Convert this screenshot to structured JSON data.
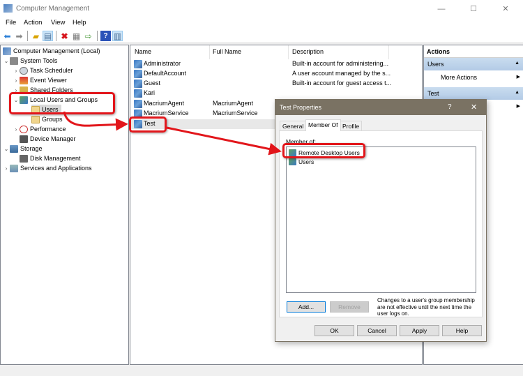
{
  "window": {
    "title": "Computer Management",
    "controls": {
      "minimize": "—",
      "maximize": "☐",
      "close": "✕"
    }
  },
  "menu": [
    "File",
    "Action",
    "View",
    "Help"
  ],
  "toolbar": {
    "icons": [
      "back-icon",
      "forward-icon",
      "up-folder-icon",
      "show-hide-tree-icon",
      "delete-icon",
      "properties-icon",
      "export-icon",
      "help-icon",
      "show-hide-action-pane-icon"
    ]
  },
  "tree": {
    "root": "Computer Management (Local)",
    "items": [
      {
        "label": "System Tools",
        "level": 1,
        "expanded": true
      },
      {
        "label": "Task Scheduler",
        "level": 2
      },
      {
        "label": "Event Viewer",
        "level": 2
      },
      {
        "label": "Shared Folders",
        "level": 2
      },
      {
        "label": "Local Users and Groups",
        "level": 2,
        "expanded": true
      },
      {
        "label": "Users",
        "level": 3,
        "selected": true
      },
      {
        "label": "Groups",
        "level": 3
      },
      {
        "label": "Performance",
        "level": 2
      },
      {
        "label": "Device Manager",
        "level": 2
      },
      {
        "label": "Storage",
        "level": 1,
        "expanded": true
      },
      {
        "label": "Disk Management",
        "level": 2
      },
      {
        "label": "Services and Applications",
        "level": 1
      }
    ]
  },
  "list": {
    "columns": [
      "Name",
      "Full Name",
      "Description"
    ],
    "rows": [
      {
        "name": "Administrator",
        "full_name": "",
        "description": "Built-in account for administering..."
      },
      {
        "name": "DefaultAccount",
        "full_name": "",
        "description": "A user account managed by the s..."
      },
      {
        "name": "Guest",
        "full_name": "",
        "description": "Built-in account for guest access t..."
      },
      {
        "name": "Kari",
        "full_name": "",
        "description": ""
      },
      {
        "name": "MacriumAgent",
        "full_name": "MacriumAgent",
        "description": ""
      },
      {
        "name": "MacriumService",
        "full_name": "MacriumService",
        "description": ""
      },
      {
        "name": "Test",
        "full_name": "",
        "description": "",
        "selected": true
      }
    ]
  },
  "actions": {
    "header": "Actions",
    "sections": [
      {
        "title": "Users",
        "items": [
          "More Actions"
        ]
      },
      {
        "title": "Test",
        "items": [
          ""
        ]
      }
    ]
  },
  "dialog": {
    "title": "Test Properties",
    "help": "?",
    "close": "✕",
    "tabs": [
      "General",
      "Member Of",
      "Profile"
    ],
    "active_tab": "Member Of",
    "member_of_label": "Member of:",
    "groups": [
      "Remote Desktop Users",
      "Users"
    ],
    "add_button": "Add...",
    "remove_button": "Remove",
    "note": "Changes to a user's group membership are not effective until the next time the user logs on.",
    "ok": "OK",
    "cancel": "Cancel",
    "apply": "Apply",
    "help_button": "Help"
  },
  "annotation_color": "#e2161b"
}
